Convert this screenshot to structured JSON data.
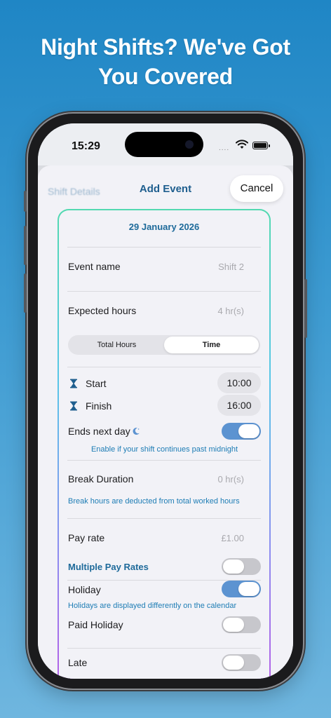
{
  "headline": {
    "line1": "Night Shifts? We've Got",
    "line2": "You Covered"
  },
  "status_bar": {
    "time": "15:29",
    "signal": "....",
    "icons": [
      "wifi-icon",
      "battery-icon"
    ]
  },
  "nav": {
    "back_label": "Shift Details",
    "title": "Add Event",
    "cancel_label": "Cancel"
  },
  "form": {
    "date": "29 January 2026",
    "event_name": {
      "label": "Event name",
      "placeholder": "Shift 2"
    },
    "expected_hours": {
      "label": "Expected hours",
      "placeholder": "4 hr(s)"
    },
    "mode_segment": {
      "options": [
        "Total Hours",
        "Time"
      ],
      "selected": "Time"
    },
    "start": {
      "label": "Start",
      "value": "10:00",
      "icon": "hourglass-icon"
    },
    "finish": {
      "label": "Finish",
      "value": "16:00",
      "icon": "hourglass-icon"
    },
    "ends_next_day": {
      "label": "Ends next day",
      "icon": "moon-icon",
      "on": true,
      "hint": "Enable if your shift continues past midnight"
    },
    "break_duration": {
      "label": "Break Duration",
      "placeholder": "0 hr(s)",
      "hint": "Break hours are deducted from total worked hours"
    },
    "pay_rate": {
      "label": "Pay rate",
      "placeholder": "£1.00"
    },
    "multiple_pay_rates": {
      "label": "Multiple Pay Rates",
      "on": false
    },
    "holiday": {
      "label": "Holiday",
      "on": true,
      "hint": "Holidays are displayed differently on the calendar"
    },
    "paid_holiday": {
      "label": "Paid Holiday",
      "on": false
    },
    "late": {
      "label": "Late",
      "on": false
    }
  },
  "colors": {
    "accent": "#1e6a9a",
    "toggle_on": "#5c93d1",
    "background_top": "#1f86c5",
    "background_bottom": "#6fb6df"
  }
}
